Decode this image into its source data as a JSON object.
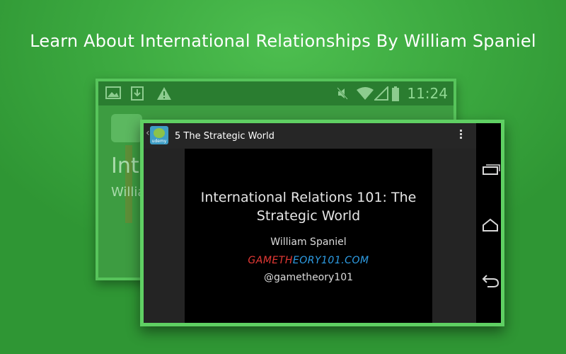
{
  "headline": "Learn About International Relationships By William Spaniel",
  "back_screen": {
    "clock": "11:24",
    "status_icons": [
      "image-icon",
      "download-icon",
      "warning-icon",
      "mute-icon",
      "wifi-icon",
      "signal-icon",
      "battery-icon"
    ],
    "title_fragment": "Inte",
    "subtitle_fragment": "Willia"
  },
  "front_screen": {
    "app_icon_label": "udemy",
    "lecture_title": "5  The Strategic World",
    "video": {
      "title_line1": "International Relations 101: The",
      "title_line2": "Strategic World",
      "author": "William Spaniel",
      "site_part1": "GAMETH",
      "site_part2": "EORY101.COM",
      "handle": "@gametheory101"
    },
    "nav": [
      "recents-icon",
      "home-icon",
      "back-icon"
    ]
  },
  "colors": {
    "background": "#3ba83f",
    "phone_border": "#5fd063",
    "site_red": "#e53935",
    "site_blue": "#2e9ee6"
  }
}
